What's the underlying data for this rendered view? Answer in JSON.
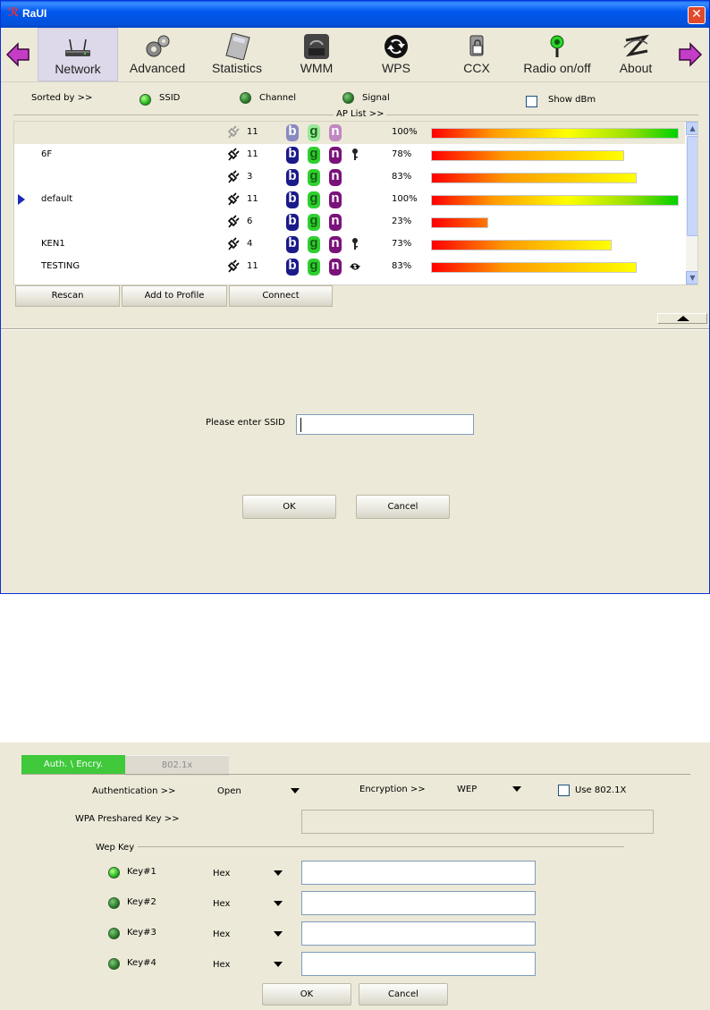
{
  "window": {
    "title": "RaUI",
    "close_glyph": "✕"
  },
  "toolbar": {
    "items": [
      {
        "label": "Network",
        "icon": "router-icon"
      },
      {
        "label": "Advanced",
        "icon": "gears-icon"
      },
      {
        "label": "Statistics",
        "icon": "calculator-icon"
      },
      {
        "label": "WMM",
        "icon": "qos-icon"
      },
      {
        "label": "WPS",
        "icon": "wps-icon"
      },
      {
        "label": "CCX",
        "icon": "ccx-icon"
      },
      {
        "label": "Radio on/off",
        "icon": "radio-icon"
      },
      {
        "label": "About",
        "icon": "about-icon"
      }
    ],
    "active": "Network"
  },
  "sort": {
    "label": "Sorted by >>",
    "options": [
      "SSID",
      "Channel",
      "Signal"
    ],
    "show_dbm": "Show dBm"
  },
  "ap_list": {
    "label": "AP List >>",
    "rows": [
      {
        "ssid": "",
        "channel": "11",
        "modes": [
          "b",
          "g",
          "n"
        ],
        "security": "",
        "signal": "100%",
        "signal_value": 100,
        "selected": true,
        "current": false
      },
      {
        "ssid": "6F",
        "channel": "11",
        "modes": [
          "b",
          "g",
          "n"
        ],
        "security": "key",
        "signal": "78%",
        "signal_value": 78,
        "selected": false,
        "current": false
      },
      {
        "ssid": "",
        "channel": "3",
        "modes": [
          "b",
          "g",
          "n"
        ],
        "security": "",
        "signal": "83%",
        "signal_value": 83,
        "selected": false,
        "current": false
      },
      {
        "ssid": "default",
        "channel": "11",
        "modes": [
          "b",
          "g",
          "n"
        ],
        "security": "",
        "signal": "100%",
        "signal_value": 100,
        "selected": false,
        "current": true
      },
      {
        "ssid": "",
        "channel": "6",
        "modes": [
          "b",
          "g",
          "n"
        ],
        "security": "",
        "signal": "23%",
        "signal_value": 23,
        "selected": false,
        "current": false
      },
      {
        "ssid": "KEN1",
        "channel": "4",
        "modes": [
          "b",
          "g",
          "n"
        ],
        "security": "key",
        "signal": "73%",
        "signal_value": 73,
        "selected": false,
        "current": false
      },
      {
        "ssid": "TESTING",
        "channel": "11",
        "modes": [
          "b",
          "g",
          "n"
        ],
        "security": "wps",
        "signal": "83%",
        "signal_value": 83,
        "selected": false,
        "current": false
      }
    ]
  },
  "buttons": {
    "rescan": "Rescan",
    "add_to_profile": "Add to Profile",
    "connect": "Connect"
  },
  "ssid_dialog": {
    "label": "Please enter SSID",
    "value": "",
    "ok": "OK",
    "cancel": "Cancel"
  },
  "security": {
    "tabs": [
      "Auth. \\ Encry.",
      "802.1x"
    ],
    "authentication_label": "Authentication >>",
    "authentication_value": "Open",
    "encryption_label": "Encryption >>",
    "encryption_value": "WEP",
    "use_8021x": "Use 802.1X",
    "wpa_psk_label": "WPA Preshared Key >>",
    "wep_key_label": "Wep Key",
    "keys": [
      {
        "label": "Key#1",
        "format": "Hex",
        "value": "",
        "selected": true
      },
      {
        "label": "Key#2",
        "format": "Hex",
        "value": "",
        "selected": false
      },
      {
        "label": "Key#3",
        "format": "Hex",
        "value": "",
        "selected": false
      },
      {
        "label": "Key#4",
        "format": "Hex",
        "value": "",
        "selected": false
      }
    ],
    "ok": "OK",
    "cancel": "Cancel"
  },
  "colors": {
    "titlebar": "#0058ee",
    "signal_start": "#ff0000",
    "signal_mid": "#ffff00",
    "signal_end": "#00d000",
    "tab_active": "#3fc93b"
  }
}
